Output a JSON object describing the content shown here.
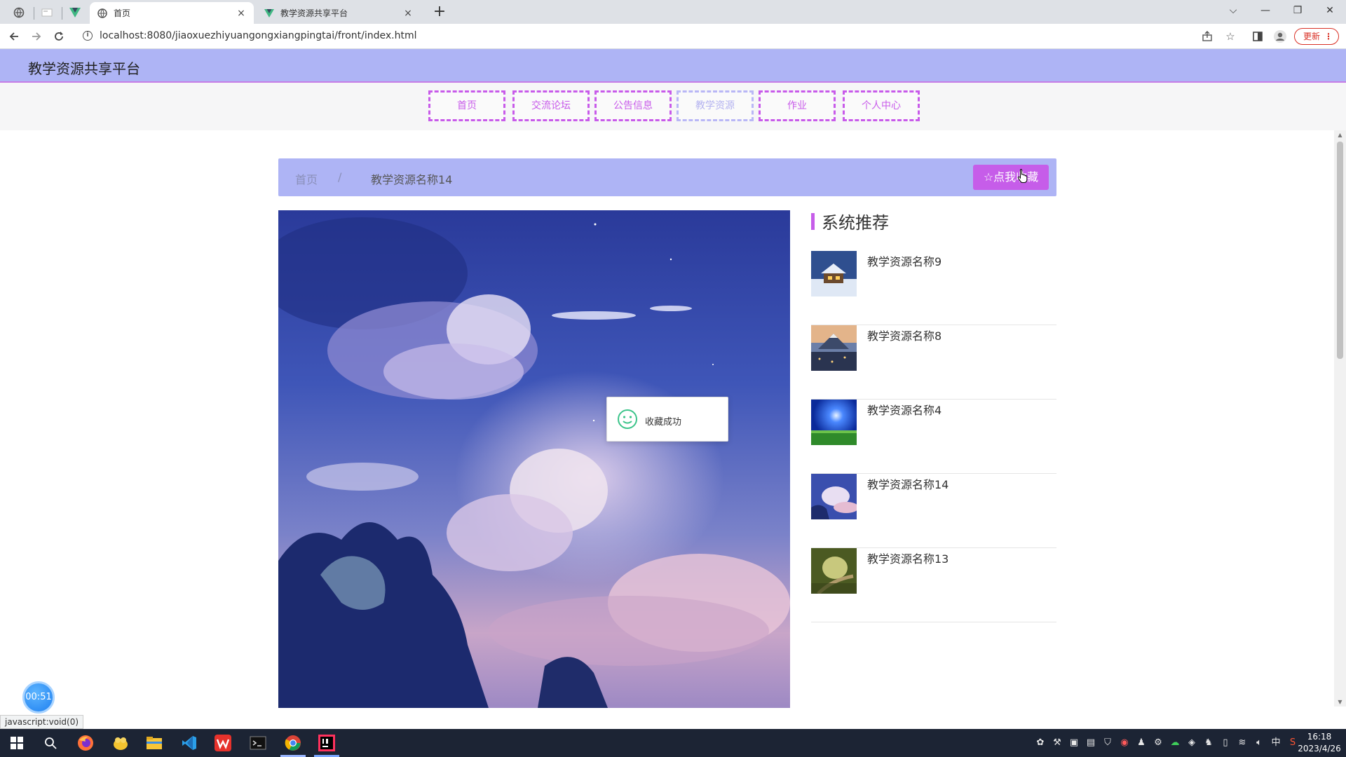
{
  "browser": {
    "tabs": [
      {
        "title": "首页",
        "active": true
      },
      {
        "title": "教学资源共享平台",
        "active": false
      }
    ],
    "close_glyph": "×",
    "new_tab_glyph": "+",
    "url": "localhost:8080/jiaoxuezhiyuangongxiangpingtai/front/index.html",
    "update_label": "更新",
    "window_controls": {
      "dropdown": "⌵",
      "minimize": "—",
      "restore": "❐",
      "close": "✕"
    }
  },
  "site": {
    "title": "教学资源共享平台",
    "menu": [
      {
        "label": "首页",
        "current": false
      },
      {
        "label": "交流论坛",
        "current": false
      },
      {
        "label": "公告信息",
        "current": false
      },
      {
        "label": "教学资源",
        "current": true
      },
      {
        "label": "作业",
        "current": false
      },
      {
        "label": "个人中心",
        "current": false
      }
    ]
  },
  "breadcrumb": {
    "home": "首页",
    "separator": "/",
    "current": "教学资源名称14"
  },
  "favorite_button": {
    "label": "点我收藏",
    "icon": "star-icon"
  },
  "toast": {
    "text": "收藏成功",
    "icon": "smile-icon"
  },
  "recommend": {
    "title": "系统推荐",
    "items": [
      {
        "name": "教学资源名称9"
      },
      {
        "name": "教学资源名称8"
      },
      {
        "name": "教学资源名称4"
      },
      {
        "name": "教学资源名称14"
      },
      {
        "name": "教学资源名称13"
      }
    ]
  },
  "overlay": {
    "timer": "00:51",
    "status_url": "javascript:void(0)"
  },
  "taskbar": {
    "clock_time": "16:18",
    "clock_date": "2023/4/26",
    "ime": "中"
  },
  "colors": {
    "header_bg": "#aeb4f5",
    "accent": "#c65de9",
    "menu_border": "#c85bea"
  }
}
